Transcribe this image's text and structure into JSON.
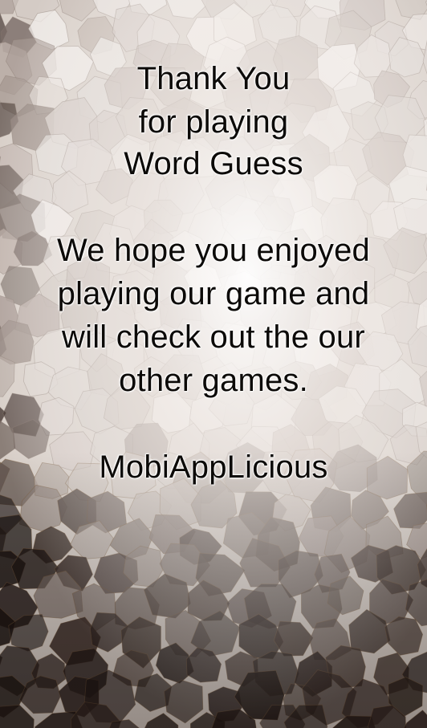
{
  "message": {
    "heading_lines": [
      "Thank You",
      "for playing",
      "Word Guess"
    ],
    "body_lines": [
      "We hope you enjoyed",
      "playing our game and",
      "will check out the our",
      "other games."
    ],
    "signature": "MobiAppLicious"
  },
  "background": {
    "style": "voronoi-bokeh-mosaic",
    "colors": {
      "light": "#f4f0ed",
      "mid": "#b9aca5",
      "dark": "#3b2d28",
      "darkest": "#1a1210",
      "edge_line": "#7a5a3c"
    }
  }
}
